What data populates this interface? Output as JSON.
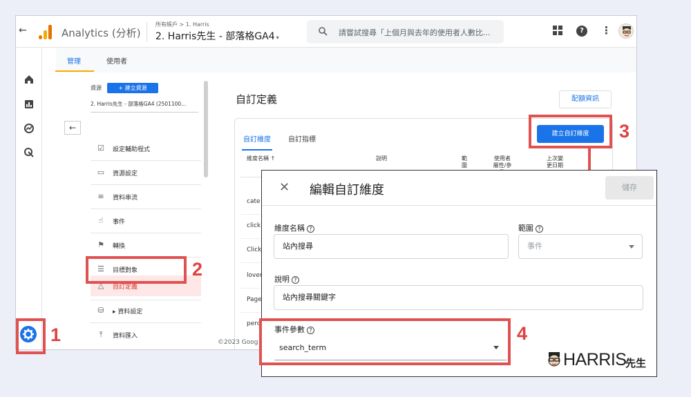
{
  "topbar": {
    "back": "←",
    "app_title": "Analytics (分析)",
    "account_crumb": "所有帳戶 > 1. Harris",
    "property_name": "2. Harris先生 - 部落格GA4",
    "property_caret": "▾",
    "search_placeholder": "請嘗試搜尋「上個月與去年的使用者人數比..."
  },
  "admin_tabs": [
    {
      "label": "管理",
      "active": true
    },
    {
      "label": "使用者",
      "active": false
    }
  ],
  "left_nav": {
    "resource_label": "資源",
    "create_resource": "+  建立資源",
    "property_select": "2. Harris先生 - 部落格GA4 (2501100...",
    "back": "←",
    "items": [
      {
        "label": "設定輔助程式",
        "icon": "checklist-icon",
        "glyph": "☑"
      },
      {
        "label": "資源設定",
        "icon": "property-settings-icon",
        "glyph": "▭"
      },
      {
        "label": "資料串流",
        "icon": "data-streams-icon",
        "glyph": "≡"
      },
      {
        "label": "事件",
        "icon": "touch-icon",
        "glyph": "☝"
      },
      {
        "label": "轉換",
        "icon": "flag-icon",
        "glyph": "⚑"
      },
      {
        "label": "目標對象",
        "icon": "audience-icon",
        "glyph": "☰"
      },
      {
        "label": "自訂定義",
        "icon": "shapes-icon",
        "glyph": "△",
        "active": true
      },
      {
        "label": "▸  資料設定",
        "icon": "database-icon",
        "glyph": "⛁"
      },
      {
        "label": "資料匯入",
        "icon": "upload-icon",
        "glyph": "⤒"
      }
    ]
  },
  "main": {
    "title": "自訂定義",
    "quota_button": "配額資訊",
    "sub_tabs": [
      {
        "label": "自訂維度",
        "active": true
      },
      {
        "label": "自訂指標",
        "active": false
      }
    ],
    "create_dimension": "建立自訂維度",
    "table_headers": [
      "維度名稱 ↑",
      "說明",
      "範\n圍",
      "使用者\n屬性/參\n數",
      "上次變\n更日期"
    ],
    "rows": [
      "cate",
      "click",
      "Click",
      "lover",
      "Page",
      "perc"
    ],
    "copyright": "©2023 Goog"
  },
  "dialog": {
    "close": "✕",
    "title": "編輯自訂維度",
    "save": "儲存",
    "dim_name_label": "維度名稱",
    "dim_name_value": "站內搜尋",
    "scope_label": "範圍",
    "scope_value": "事件",
    "desc_label": "說明",
    "desc_value": "站內搜尋關鍵字",
    "param_label": "事件參數",
    "param_value": "search_term",
    "help": "?"
  },
  "annotations": {
    "numbers": [
      "1",
      "2",
      "3",
      "4"
    ],
    "highlight_color": "#e05252"
  },
  "brand": {
    "text": "HARRIS",
    "sub": "先生"
  },
  "colors": {
    "primary": "#1a73e8",
    "accent_orange": "#f9ab00",
    "highlight_red": "#e05252"
  }
}
